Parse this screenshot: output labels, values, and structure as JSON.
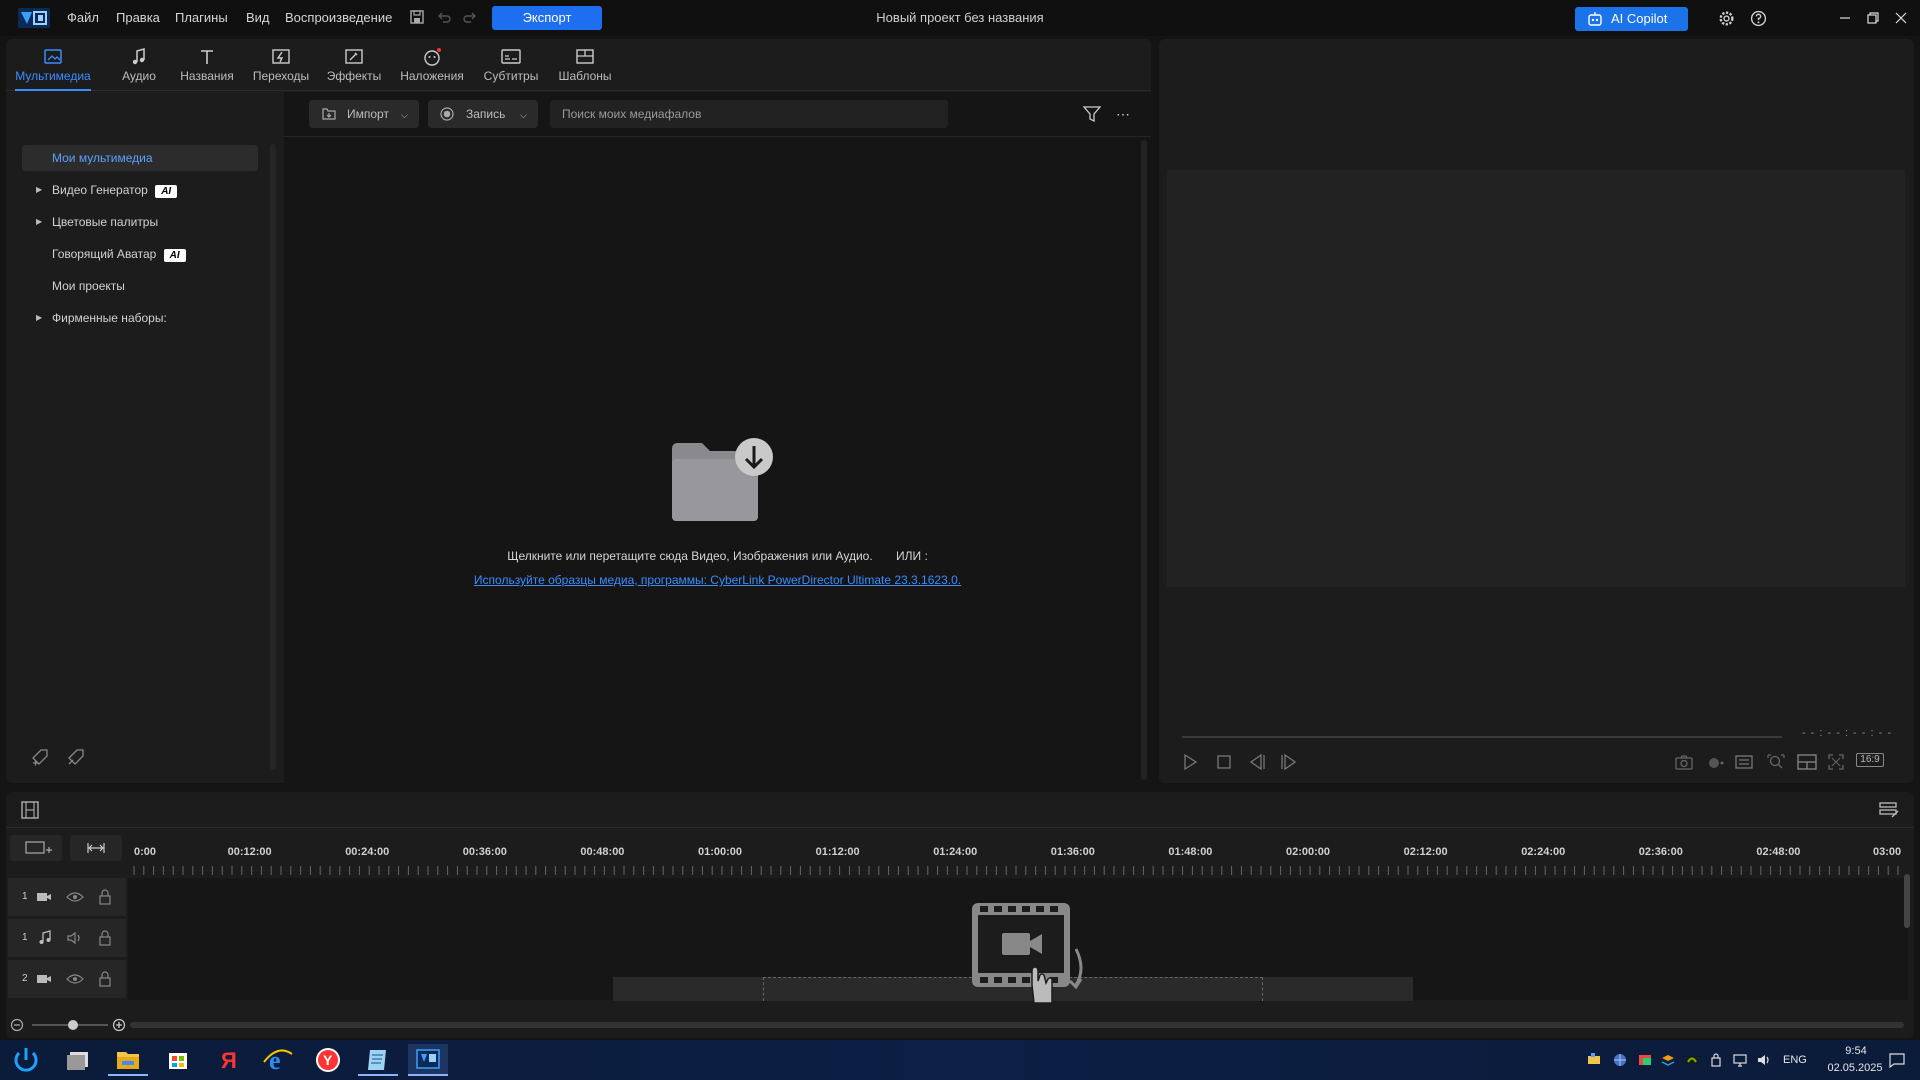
{
  "titlebar": {
    "menu": [
      "Файл",
      "Правка",
      "Плагины",
      "Вид",
      "Воспроизведение"
    ],
    "export_label": "Экспорт",
    "project_title": "Новый проект без названия",
    "ai_copilot_label": "AI Copilot"
  },
  "tabs": [
    {
      "label": "Мультимедиа",
      "active": true
    },
    {
      "label": "Аудио"
    },
    {
      "label": "Названия"
    },
    {
      "label": "Переходы"
    },
    {
      "label": "Эффекты"
    },
    {
      "label": "Наложения"
    },
    {
      "label": "Субтитры"
    },
    {
      "label": "Шаблоны"
    }
  ],
  "sidebar": {
    "items": [
      {
        "label": "Мои мультимедиа",
        "active": true
      },
      {
        "label": "Видео Генератор",
        "badge": "AI"
      },
      {
        "label": "Цветовые палитры"
      },
      {
        "label": "Говорящий Аватар",
        "badge": "AI"
      },
      {
        "label": "Мои проекты"
      },
      {
        "label": "Фирменные наборы:"
      }
    ]
  },
  "media": {
    "import_label": "Импорт",
    "record_label": "Запись",
    "search_placeholder": "Поиск моих медиафалов",
    "empty_message": "Щелкните или перетащите сюда Видео, Изображения или Аудио.",
    "or_label": "ИЛИ :",
    "sample_link": "Используйте образцы медиа, программы: CyberLink PowerDirector Ultimate 23.3.1623.0."
  },
  "preview": {
    "timecode": "- - : - - : - - : - -",
    "aspect": "16:9"
  },
  "timeline": {
    "ruler": [
      "0:00",
      "00:12:00",
      "00:24:00",
      "00:36:00",
      "00:48:00",
      "01:00:00",
      "01:12:00",
      "01:24:00",
      "01:36:00",
      "01:48:00",
      "02:00:00",
      "02:12:00",
      "02:24:00",
      "02:36:00",
      "02:48:00",
      "03:00"
    ],
    "tracks": [
      {
        "num": "1",
        "type": "video"
      },
      {
        "num": "1",
        "type": "audio"
      },
      {
        "num": "2",
        "type": "video"
      }
    ]
  },
  "taskbar": {
    "lang": "ENG",
    "time": "9:54",
    "date": "02.05.2025"
  },
  "colors": {
    "accent": "#1e6ef0",
    "link": "#3a8dff"
  }
}
